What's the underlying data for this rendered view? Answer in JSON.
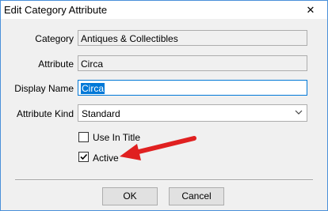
{
  "window": {
    "title": "Edit Category Attribute",
    "close_glyph": "✕"
  },
  "form": {
    "category": {
      "label": "Category",
      "value": "Antiques & Collectibles"
    },
    "attribute": {
      "label": "Attribute",
      "value": "Circa"
    },
    "display_name": {
      "label": "Display Name",
      "value": "Circa"
    },
    "attribute_kind": {
      "label": "Attribute Kind",
      "value": "Standard"
    },
    "use_in_title": {
      "label": "Use In Title",
      "checked": false
    },
    "active": {
      "label": "Active",
      "checked": true
    }
  },
  "buttons": {
    "ok": "OK",
    "cancel": "Cancel"
  },
  "annotation": {
    "color": "#e02020"
  }
}
